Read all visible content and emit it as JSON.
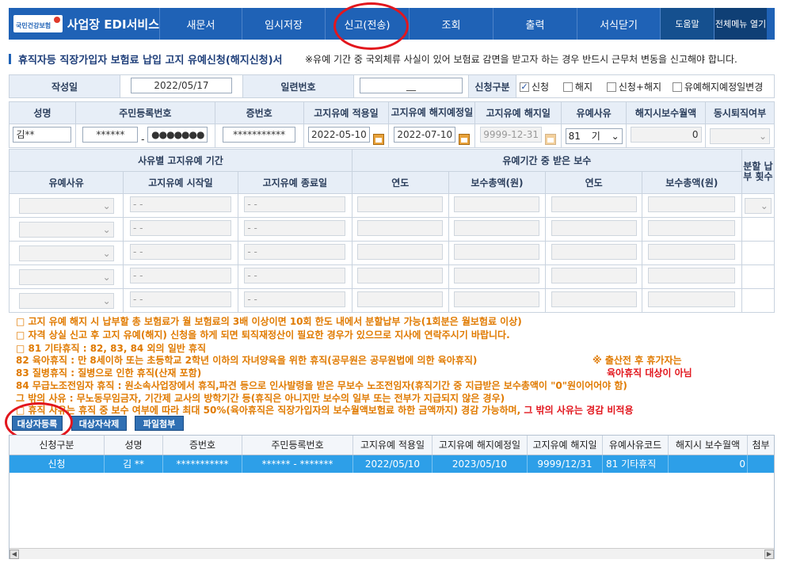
{
  "nav": {
    "brand_small": "국민건강보험",
    "brand": "사업장 EDI서비스",
    "items": [
      "새문서",
      "임시저장",
      "신고(전송)",
      "조회",
      "출력",
      "서식닫기"
    ],
    "help": "도움말",
    "all_menu": "전체메뉴 열기"
  },
  "page": {
    "title": "휴직자등 직장가입자 보험료 납입 고지 유예신청(해지신청)서",
    "notice": "※유예 기간 중 국외체류 사실이 있어 보험료 감면을 받고자 하는 경우 반드시 근무처 변동을 신고해야 합니다."
  },
  "form1": {
    "write_date_label": "작성일",
    "write_date": "2022/05/17",
    "serial_label": "일련번호",
    "serial": "__",
    "type_label": "신청구분",
    "options": [
      {
        "label": "신청",
        "checked": true
      },
      {
        "label": "해지",
        "checked": false
      },
      {
        "label": "신청+해지",
        "checked": false
      },
      {
        "label": "유예해지예정일변경",
        "checked": false
      }
    ]
  },
  "form2": {
    "headers": [
      "성명",
      "주민등록번호",
      "증번호",
      "고지유예 적용일",
      "고지유예 해지예정일",
      "고지유예 해지일",
      "유예사유",
      "해지시보수월액",
      "동시퇴직여부"
    ],
    "name": "김**",
    "rrn1": "******",
    "rrn_sep": "-",
    "rrn2": "●●●●●●●",
    "cert_no": "***********",
    "apply_date": "2022-05-10",
    "planned_end": "2022-07-10",
    "end_date": "9999-12-31",
    "reason_code": "81",
    "reason_more": "기",
    "salary": "0"
  },
  "form3": {
    "group1": "사유별 고지유예 기간",
    "group2": "유예기간 중 받은 보수",
    "group3": "분할 납부 횟수",
    "cols": [
      "유예사유",
      "고지유예 시작일",
      "고지유예 종료일",
      "연도",
      "보수총액(원)",
      "연도",
      "보수총액(원)"
    ],
    "date_placeholder": "-   -"
  },
  "notes": {
    "lines": [
      "□ 고지 유예 해지 시 납부할 총 보험료가 월 보험료의 3배 이상이면 10회 한도 내에서 분할납부 가능(1회분은 월보험료 이상)",
      "□ 자격 상실 신고 후 고지 유예(해지) 신청을 하게 되면 퇴직재정산이 필요한 경우가 있으므로 지사에 연락주시기 바랍니다.",
      "□ 81 기타휴직 : 82, 83, 84 외의 일반 휴직",
      "   82 육아휴직 : 만 8세이하 또는 초등학교 2학년 이하의 자녀양육을 위한 휴직(공무원은 공무원법에 의한 육아휴직)",
      "   83 질병휴직 : 질병으로 인한 휴직(산재 포함)",
      "   84 무급노조전임자 휴직 : 원소속사업장에서 휴직,파견 등으로 인사발령을 받은 무보수 노조전임자(휴직기간 중 지급받은 보수총액이 \"0\"원이어어야 함)",
      "   그 밖의 사유 : 무노동무임금자, 기간제 교사의 방학기간 등(휴직은 아니지만 보수의 일부 또는 전부가 지급되지 않은 경우)",
      "□ 휴직 사유는 휴직 중 보수 여부에 따라 최대 50%(육아휴직은 직장가입자의 보수월액보험료 하한 금액까지) 경감 가능하며, "
    ],
    "red_tail": "그 밖의 사유는 경감 비적용",
    "side1": "※ 출산전 후 휴가자는",
    "side2": "육아휴직 대상이 아님"
  },
  "buttons": {
    "register": "대상자등록",
    "delete": "대상자삭제",
    "attach": "파일첨부"
  },
  "grid": {
    "headers": [
      "신청구분",
      "성명",
      "증번호",
      "주민등록번호",
      "고지유예 적용일",
      "고지유예 해지예정일",
      "고지유예 해지일",
      "유예사유코드",
      "해지시 보수월액",
      "첨부"
    ],
    "row": [
      "신청",
      "김 **",
      "***********",
      "****** - *******",
      "2022/05/10",
      "2023/05/10",
      "9999/12/31",
      "81     기타휴직",
      "0",
      ""
    ]
  },
  "colors": {
    "nav": "#1f62b6",
    "selected_row": "#2d9fe8",
    "note": "#e07a00",
    "red": "#e2161d"
  }
}
